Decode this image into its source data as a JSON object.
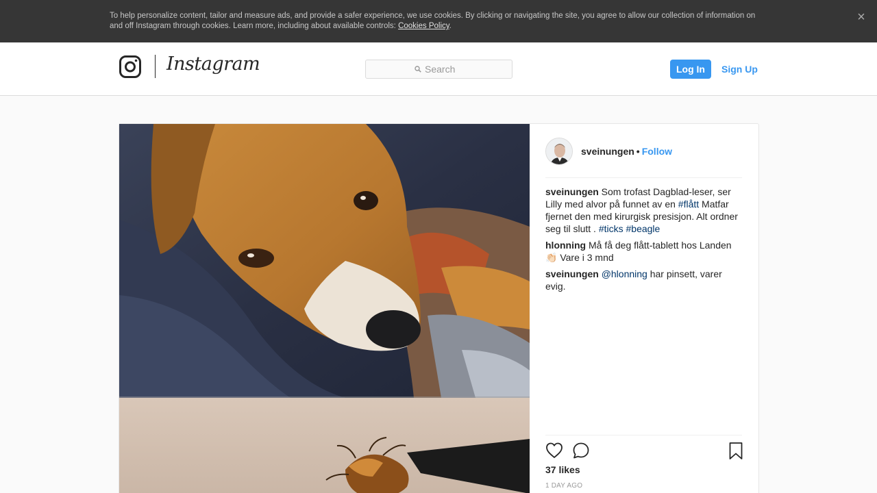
{
  "cookie_banner": {
    "text": "To help personalize content, tailor and measure ads, and provide a safer experience, we use cookies. By clicking or navigating the site, you agree to allow our collection of information on and off Instagram through cookies. Learn more, including about available controls: ",
    "link_text": "Cookies Policy",
    "suffix": ".",
    "close_icon": "close-icon"
  },
  "header": {
    "logo_word": "Instagram",
    "logo_icon": "instagram-camera-icon",
    "search_placeholder": "Search",
    "search_icon": "search-icon",
    "login_label": "Log In",
    "signup_label": "Sign Up"
  },
  "post": {
    "owner": "sveinungen",
    "separator": "•",
    "follow_label": "Follow",
    "caption": {
      "user": "sveinungen",
      "text_1": " Som trofast Dagblad-leser, ser Lilly med alvor på funnet av en ",
      "tag_1": "#flått",
      "text_2": " Matfar fjernet den med kirurgisk presisjon. Alt ordner seg til slutt . ",
      "tag_2": "#ticks",
      "space": " ",
      "tag_3": "#beagle"
    },
    "comments": [
      {
        "user": "hlonning",
        "text": " Må få deg flått-tablett hos Landen 👏🏻 Vare i 3 mnd"
      },
      {
        "user": "sveinungen",
        "mention": "@hlonning",
        "text": " har pinsett, varer evig."
      }
    ],
    "likes": "37 likes",
    "time_ago": "1 DAY AGO",
    "icons": [
      "heart-icon",
      "comment-icon",
      "bookmark-icon"
    ]
  },
  "colors": {
    "accent": "#3897f0",
    "banner_bg": "#363636",
    "hashtag": "#003569"
  }
}
